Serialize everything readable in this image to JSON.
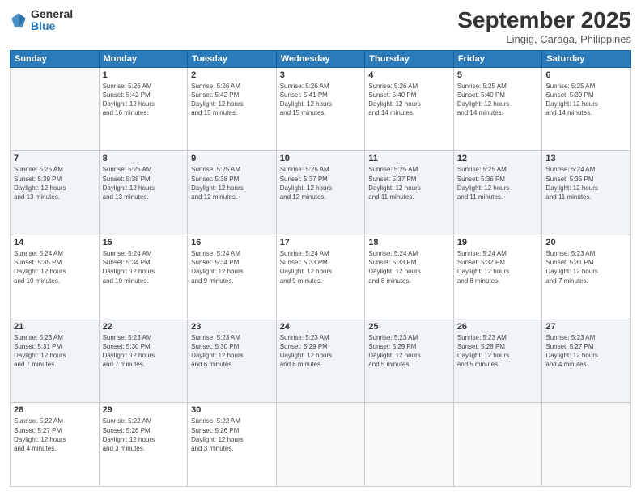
{
  "logo": {
    "general": "General",
    "blue": "Blue"
  },
  "header": {
    "title": "September 2025",
    "subtitle": "Lingig, Caraga, Philippines"
  },
  "weekdays": [
    "Sunday",
    "Monday",
    "Tuesday",
    "Wednesday",
    "Thursday",
    "Friday",
    "Saturday"
  ],
  "weeks": [
    [
      {
        "day": "",
        "info": ""
      },
      {
        "day": "1",
        "info": "Sunrise: 5:26 AM\nSunset: 5:42 PM\nDaylight: 12 hours\nand 16 minutes."
      },
      {
        "day": "2",
        "info": "Sunrise: 5:26 AM\nSunset: 5:42 PM\nDaylight: 12 hours\nand 15 minutes."
      },
      {
        "day": "3",
        "info": "Sunrise: 5:26 AM\nSunset: 5:41 PM\nDaylight: 12 hours\nand 15 minutes."
      },
      {
        "day": "4",
        "info": "Sunrise: 5:26 AM\nSunset: 5:40 PM\nDaylight: 12 hours\nand 14 minutes."
      },
      {
        "day": "5",
        "info": "Sunrise: 5:25 AM\nSunset: 5:40 PM\nDaylight: 12 hours\nand 14 minutes."
      },
      {
        "day": "6",
        "info": "Sunrise: 5:25 AM\nSunset: 5:39 PM\nDaylight: 12 hours\nand 14 minutes."
      }
    ],
    [
      {
        "day": "7",
        "info": "Sunrise: 5:25 AM\nSunset: 5:39 PM\nDaylight: 12 hours\nand 13 minutes."
      },
      {
        "day": "8",
        "info": "Sunrise: 5:25 AM\nSunset: 5:38 PM\nDaylight: 12 hours\nand 13 minutes."
      },
      {
        "day": "9",
        "info": "Sunrise: 5:25 AM\nSunset: 5:38 PM\nDaylight: 12 hours\nand 12 minutes."
      },
      {
        "day": "10",
        "info": "Sunrise: 5:25 AM\nSunset: 5:37 PM\nDaylight: 12 hours\nand 12 minutes."
      },
      {
        "day": "11",
        "info": "Sunrise: 5:25 AM\nSunset: 5:37 PM\nDaylight: 12 hours\nand 11 minutes."
      },
      {
        "day": "12",
        "info": "Sunrise: 5:25 AM\nSunset: 5:36 PM\nDaylight: 12 hours\nand 11 minutes."
      },
      {
        "day": "13",
        "info": "Sunrise: 5:24 AM\nSunset: 5:35 PM\nDaylight: 12 hours\nand 11 minutes."
      }
    ],
    [
      {
        "day": "14",
        "info": "Sunrise: 5:24 AM\nSunset: 5:35 PM\nDaylight: 12 hours\nand 10 minutes."
      },
      {
        "day": "15",
        "info": "Sunrise: 5:24 AM\nSunset: 5:34 PM\nDaylight: 12 hours\nand 10 minutes."
      },
      {
        "day": "16",
        "info": "Sunrise: 5:24 AM\nSunset: 5:34 PM\nDaylight: 12 hours\nand 9 minutes."
      },
      {
        "day": "17",
        "info": "Sunrise: 5:24 AM\nSunset: 5:33 PM\nDaylight: 12 hours\nand 9 minutes."
      },
      {
        "day": "18",
        "info": "Sunrise: 5:24 AM\nSunset: 5:33 PM\nDaylight: 12 hours\nand 8 minutes."
      },
      {
        "day": "19",
        "info": "Sunrise: 5:24 AM\nSunset: 5:32 PM\nDaylight: 12 hours\nand 8 minutes."
      },
      {
        "day": "20",
        "info": "Sunrise: 5:23 AM\nSunset: 5:31 PM\nDaylight: 12 hours\nand 7 minutes."
      }
    ],
    [
      {
        "day": "21",
        "info": "Sunrise: 5:23 AM\nSunset: 5:31 PM\nDaylight: 12 hours\nand 7 minutes."
      },
      {
        "day": "22",
        "info": "Sunrise: 5:23 AM\nSunset: 5:30 PM\nDaylight: 12 hours\nand 7 minutes."
      },
      {
        "day": "23",
        "info": "Sunrise: 5:23 AM\nSunset: 5:30 PM\nDaylight: 12 hours\nand 6 minutes."
      },
      {
        "day": "24",
        "info": "Sunrise: 5:23 AM\nSunset: 5:29 PM\nDaylight: 12 hours\nand 6 minutes."
      },
      {
        "day": "25",
        "info": "Sunrise: 5:23 AM\nSunset: 5:29 PM\nDaylight: 12 hours\nand 5 minutes."
      },
      {
        "day": "26",
        "info": "Sunrise: 5:23 AM\nSunset: 5:28 PM\nDaylight: 12 hours\nand 5 minutes."
      },
      {
        "day": "27",
        "info": "Sunrise: 5:23 AM\nSunset: 5:27 PM\nDaylight: 12 hours\nand 4 minutes."
      }
    ],
    [
      {
        "day": "28",
        "info": "Sunrise: 5:22 AM\nSunset: 5:27 PM\nDaylight: 12 hours\nand 4 minutes."
      },
      {
        "day": "29",
        "info": "Sunrise: 5:22 AM\nSunset: 5:26 PM\nDaylight: 12 hours\nand 3 minutes."
      },
      {
        "day": "30",
        "info": "Sunrise: 5:22 AM\nSunset: 5:26 PM\nDaylight: 12 hours\nand 3 minutes."
      },
      {
        "day": "",
        "info": ""
      },
      {
        "day": "",
        "info": ""
      },
      {
        "day": "",
        "info": ""
      },
      {
        "day": "",
        "info": ""
      }
    ]
  ]
}
